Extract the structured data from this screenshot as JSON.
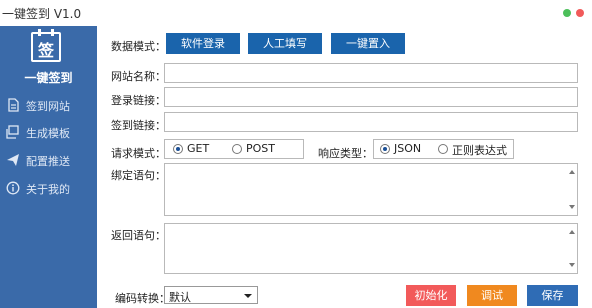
{
  "window": {
    "title": "一键签到 V1.0"
  },
  "sidebar": {
    "logo_glyph": "签",
    "brand": "一键签到",
    "items": [
      {
        "label": "签到网站",
        "icon": "document-icon"
      },
      {
        "label": "生成模板",
        "icon": "stack-icon"
      },
      {
        "label": "配置推送",
        "icon": "send-icon"
      },
      {
        "label": "关于我的",
        "icon": "info-icon"
      }
    ]
  },
  "form": {
    "data_mode_label": "数据模式：",
    "mode_buttons": [
      "软件登录",
      "人工填写",
      "一键置入"
    ],
    "site_name_label": "网站名称：",
    "login_link_label": "登录链接：",
    "signin_link_label": "签到链接：",
    "request_mode_label": "请求模式：",
    "request_options": [
      "GET",
      "POST"
    ],
    "request_selected": "GET",
    "response_type_label": "响应类型：",
    "response_options": [
      "JSON",
      "正则表达式"
    ],
    "response_selected": "JSON",
    "bind_label": "绑定语句：",
    "return_label": "返回语句：",
    "encoding_label": "编码转换：",
    "encoding_value": "默认"
  },
  "actions": {
    "init_label": "初始化",
    "debug_label": "调试",
    "save_label": "保存"
  },
  "colors": {
    "sidebar": "#3a6aa9",
    "primary_button": "#1a64ac",
    "init_button": "#f25a5a",
    "debug_button": "#f0891f",
    "save_button": "#2f6cb5"
  }
}
